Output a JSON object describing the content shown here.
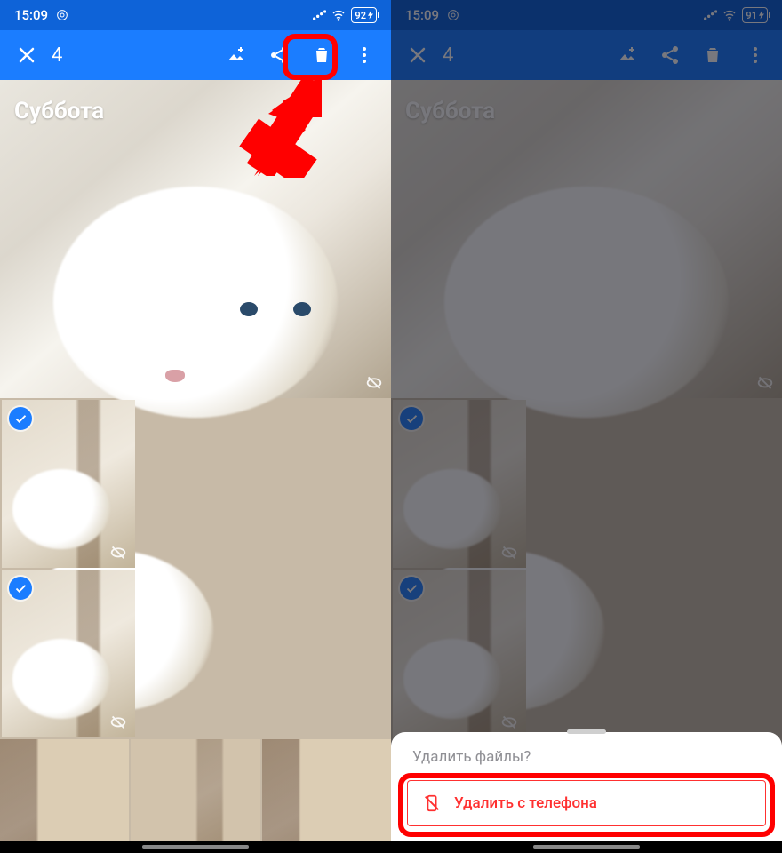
{
  "status": {
    "time": "15:09",
    "battery_left": "92",
    "battery_right": "91"
  },
  "toolbar": {
    "selection_count": "4",
    "close_name": "close-icon",
    "addto_name": "add-to-album-icon",
    "share_name": "share-icon",
    "trash_name": "trash-icon",
    "more_name": "more-vert-icon"
  },
  "gallery": {
    "date_heading": "Суббота"
  },
  "sheet": {
    "prompt": "Удалить файлы?",
    "delete_label": "Удалить с телефона"
  },
  "colors": {
    "primary": "#1b7dff",
    "status": "#0e63d8",
    "danger": "#ff3030",
    "highlight": "#f00"
  }
}
